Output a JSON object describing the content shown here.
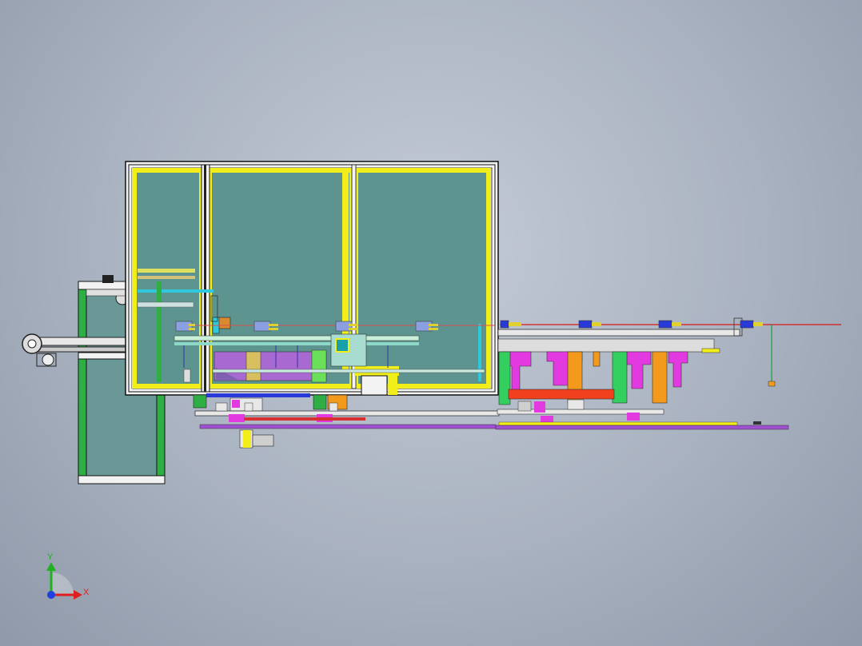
{
  "viewport": {
    "view": "front-elevation",
    "background_top": "#c4cbd6",
    "background_bottom": "#8f99a9"
  },
  "colors": {
    "frame_yellow": "#f2ee1a",
    "glass": "#5e9490",
    "profile_white": "#f4f4f4",
    "profile_black": "#141414",
    "green_panel": "#33b24a",
    "magenta": "#e23ae0",
    "orange": "#f39a1c",
    "red_bar": "#f0401c",
    "purple_rail": "#a04fd0",
    "blue_cylinder": "#2a3ad8",
    "cyan": "#33d0e0",
    "laser_red": "#d81818"
  },
  "triad": {
    "x_label": "X",
    "y_label": "Y",
    "x_color": "#e02020",
    "y_color": "#20b020",
    "z_color": "#2040e0"
  }
}
